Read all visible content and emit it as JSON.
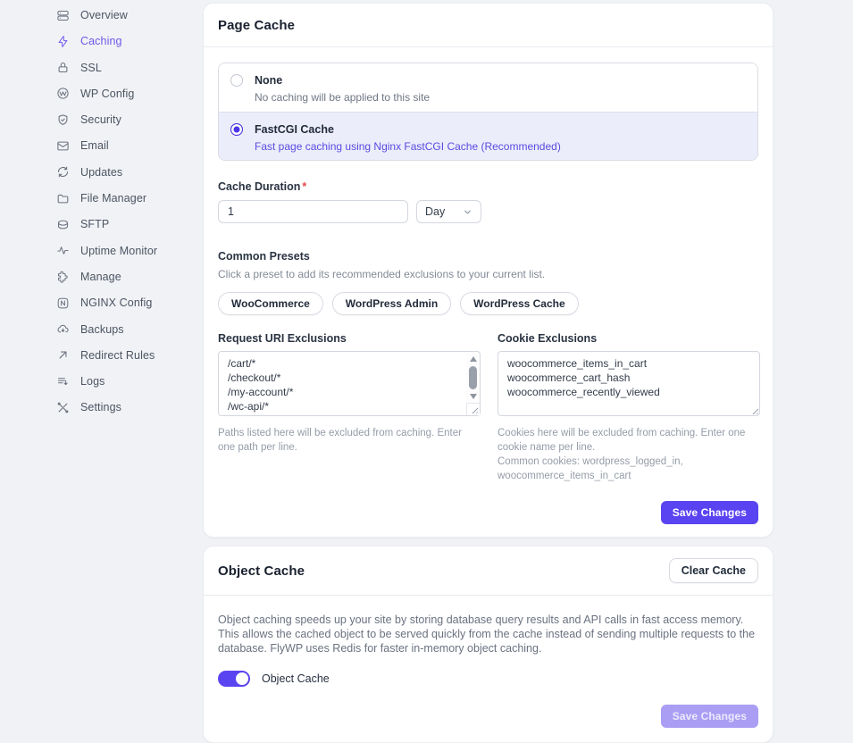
{
  "theme": {
    "accent": "#5a43f0",
    "accent_light_bg": "#ecedfb",
    "accent_disabled": "#a99ef3",
    "sidebar_active": "#6d58e8",
    "page_bg": "#f1f2f5",
    "border": "#d9dce3",
    "helper_text": "#959ca8"
  },
  "sidebar": {
    "items": [
      {
        "label": "Overview",
        "icon": "server-stack-icon",
        "active": false
      },
      {
        "label": "Caching",
        "icon": "lightning-icon",
        "active": true
      },
      {
        "label": "SSL",
        "icon": "lock-icon",
        "active": false
      },
      {
        "label": "WP Config",
        "icon": "wordpress-icon",
        "active": false
      },
      {
        "label": "Security",
        "icon": "shield-check-icon",
        "active": false
      },
      {
        "label": "Email",
        "icon": "envelope-icon",
        "active": false
      },
      {
        "label": "Updates",
        "icon": "refresh-icon",
        "active": false
      },
      {
        "label": "File Manager",
        "icon": "folder-icon",
        "active": false
      },
      {
        "label": "SFTP",
        "icon": "server-icon",
        "active": false
      },
      {
        "label": "Uptime Monitor",
        "icon": "activity-icon",
        "active": false
      },
      {
        "label": "Manage",
        "icon": "puzzle-icon",
        "active": false
      },
      {
        "label": "NGINX Config",
        "icon": "nginx-icon",
        "active": false
      },
      {
        "label": "Backups",
        "icon": "cloud-download-icon",
        "active": false
      },
      {
        "label": "Redirect Rules",
        "icon": "arrow-up-right-icon",
        "active": false
      },
      {
        "label": "Logs",
        "icon": "log-lines-icon",
        "active": false
      },
      {
        "label": "Settings",
        "icon": "tools-icon",
        "active": false
      }
    ]
  },
  "page_cache": {
    "title": "Page Cache",
    "options": [
      {
        "label": "None",
        "description": "No caching will be applied to this site",
        "selected": false
      },
      {
        "label": "FastCGI Cache",
        "description": "Fast page caching using Nginx FastCGI Cache (Recommended)",
        "selected": true
      }
    ],
    "cache_duration": {
      "label": "Cache Duration",
      "required_marker": "*",
      "value": "1",
      "unit_selected": "Day"
    },
    "common_presets": {
      "label": "Common Presets",
      "hint": "Click a preset to add its recommended exclusions to your current list.",
      "presets": [
        "WooCommerce",
        "WordPress Admin",
        "WordPress Cache"
      ]
    },
    "request_uri_exclusions": {
      "label": "Request URI Exclusions",
      "value": "/cart/*\n/checkout/*\n/my-account/*\n/wc-api/*",
      "help": "Paths listed here will be excluded from caching. Enter one path per line."
    },
    "cookie_exclusions": {
      "label": "Cookie Exclusions",
      "value": "woocommerce_items_in_cart\nwoocommerce_cart_hash\nwoocommerce_recently_viewed",
      "help": "Cookies here will be excluded from caching. Enter one cookie name per line.",
      "help2": "Common cookies: wordpress_logged_in, woocommerce_items_in_cart"
    },
    "save_label": "Save Changes"
  },
  "object_cache": {
    "title": "Object Cache",
    "clear_cache_label": "Clear Cache",
    "description": "Object caching speeds up your site by storing database query results and API calls in fast access memory. This allows the cached object to be served quickly from the cache instead of sending multiple requests to the database. FlyWP uses Redis for faster in-memory object caching.",
    "toggle_label": "Object Cache",
    "toggle_state": "on",
    "save_label": "Save Changes"
  }
}
